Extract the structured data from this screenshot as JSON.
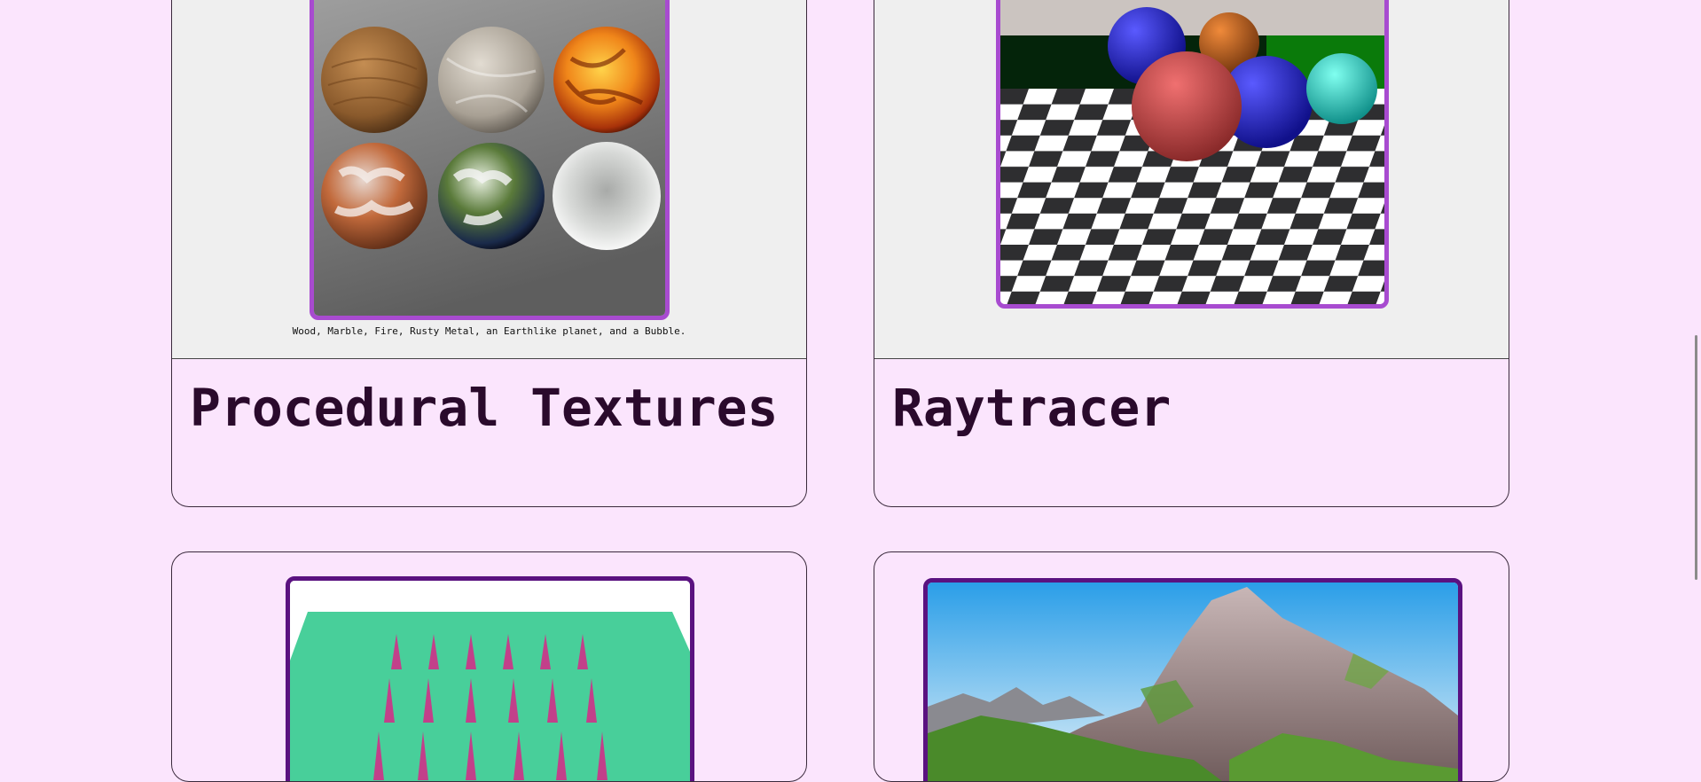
{
  "projects": [
    {
      "title": "Procedural Textures",
      "caption": "Wood, Marble, Fire, Rusty Metal, an Earthlike planet, and a Bubble."
    },
    {
      "title": "Raytracer",
      "caption": ""
    }
  ],
  "colors": {
    "page_background": "#fbe5fd",
    "preview_background": "#efefef",
    "frame_border": "#a84bd0",
    "frame_border_dark": "#5a1280",
    "title_text": "#2a0a2c"
  },
  "icons": {
    "scrollbar": "scrollbar-thumb"
  }
}
